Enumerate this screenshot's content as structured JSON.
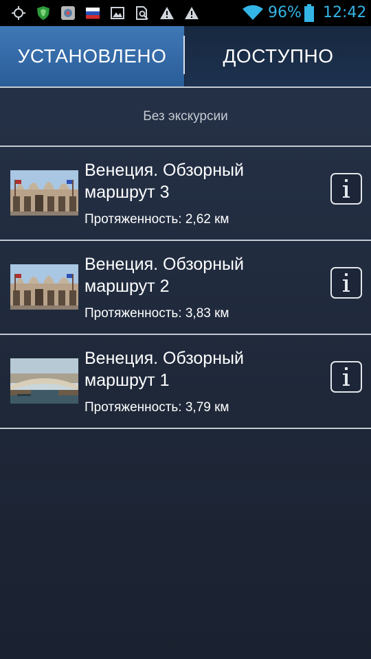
{
  "status_bar": {
    "icons": [
      "target-icon",
      "shield-icon",
      "app-icon",
      "flag-icon",
      "image-icon",
      "search-file-icon",
      "warning-icon",
      "warning-icon",
      "wifi-icon",
      "battery-icon"
    ],
    "battery": "96%",
    "time": "12:42"
  },
  "tabs": {
    "installed_label": "УСТАНОВЛЕНО",
    "available_label": "ДОСТУПНО"
  },
  "no_tour_label": "Без экскурсии",
  "routes": [
    {
      "title": "Венеция. Обзорный маршрут 3",
      "length": "Протяженность: 2,62 км",
      "thumb": "basilica"
    },
    {
      "title": "Венеция. Обзорный маршрут 2",
      "length": "Протяженность: 3,83 км",
      "thumb": "basilica"
    },
    {
      "title": "Венеция. Обзорный маршрут 1",
      "length": "Протяженность: 3,79 км",
      "thumb": "bridge"
    }
  ],
  "colors": {
    "accent": "#33b5e5",
    "tab_active": "#3f78b6",
    "background": "#222c3f"
  }
}
